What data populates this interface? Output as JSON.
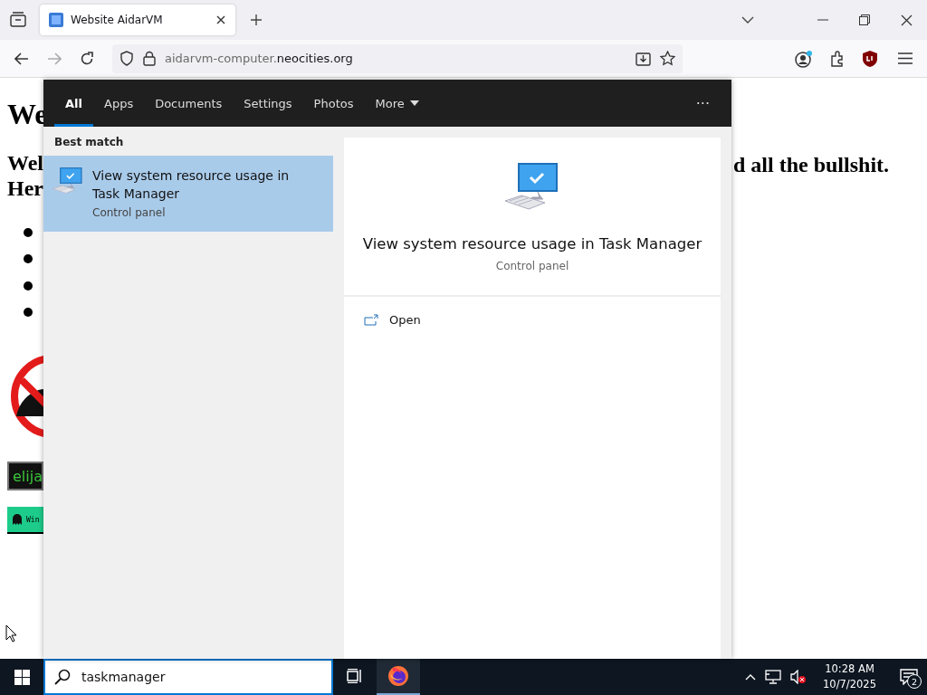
{
  "browser": {
    "tabs": [
      {
        "title": "Website AidarVM",
        "selected": true
      }
    ],
    "url": {
      "subdomain": "aidarvm-computer.",
      "domain": "neocities.org"
    }
  },
  "page": {
    "heading": "We",
    "intro_lines": [
      "Wel",
      "Her"
    ],
    "intro_right": "d all the bullshit.",
    "bullets": [
      {
        "kind": "bullet"
      },
      {
        "kind": "bullet"
      },
      {
        "kind": "bullet"
      },
      {
        "kind": "bullet"
      }
    ],
    "badge": "elija",
    "button": "Win"
  },
  "search": {
    "tabs": [
      {
        "label": "All",
        "selected": true
      },
      {
        "label": "Apps",
        "selected": false
      },
      {
        "label": "Documents",
        "selected": false
      },
      {
        "label": "Settings",
        "selected": false
      },
      {
        "label": "Photos",
        "selected": false
      }
    ],
    "more": "More",
    "options": "···",
    "section": "Best match",
    "results": [
      {
        "title": "View system resource usage in Task Manager",
        "subtitle": "Control panel",
        "selected": true
      }
    ],
    "preview": {
      "title": "View system resource usage in Task Manager",
      "subtitle": "Control panel"
    },
    "actions": [
      {
        "label": "Open"
      }
    ]
  },
  "taskbar": {
    "query": "taskmanager",
    "apps": [
      {
        "kind": "task-view",
        "active": false
      },
      {
        "kind": "firefox",
        "active": true
      }
    ],
    "time": "10:28 AM",
    "date": "10/7/2025",
    "notifications": "2"
  }
}
